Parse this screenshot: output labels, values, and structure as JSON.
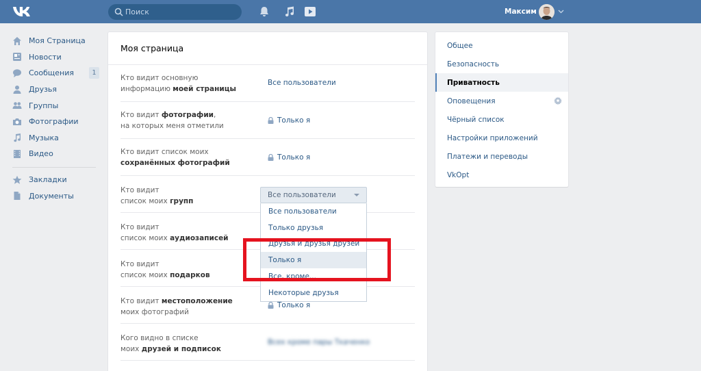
{
  "header": {
    "logo_icon": "vk-logo-icon",
    "search_placeholder": "Поиск",
    "user_name": "Максим",
    "brand_color": "#4a76a8"
  },
  "left_menu": {
    "items": [
      {
        "label": "Моя Страница",
        "icon": "home-icon"
      },
      {
        "label": "Новости",
        "icon": "news-icon"
      },
      {
        "label": "Сообщения",
        "icon": "messages-icon",
        "badge": "1"
      },
      {
        "label": "Друзья",
        "icon": "friends-icon"
      },
      {
        "label": "Группы",
        "icon": "groups-icon"
      },
      {
        "label": "Фотографии",
        "icon": "camera-icon"
      },
      {
        "label": "Музыка",
        "icon": "music-icon"
      },
      {
        "label": "Видео",
        "icon": "video-icon"
      }
    ],
    "items2": [
      {
        "label": "Закладки",
        "icon": "star-icon"
      },
      {
        "label": "Документы",
        "icon": "document-icon"
      }
    ]
  },
  "main": {
    "title": "Моя страница",
    "rows": [
      {
        "l1": "Кто видит основную",
        "l2a": "информацию ",
        "l2b": "моей страницы",
        "value": "Все пользователи"
      },
      {
        "l1a": "Кто видит ",
        "l1b": "фотографии",
        "l1c": ",",
        "l2": "на которых меня отметили",
        "value": "Только я"
      },
      {
        "l1": "Кто видит список моих",
        "l2b": "сохранённых фотографий",
        "value": "Только я"
      },
      {
        "l1": "Кто видит",
        "l2a": "список моих ",
        "l2b": "групп"
      },
      {
        "l1": "Кто видит",
        "l2a": "список моих ",
        "l2b": "аудиозаписей"
      },
      {
        "l1": "Кто видит",
        "l2a": "список моих ",
        "l2b": "подарков"
      },
      {
        "l1a": "Кто видит ",
        "l1b": "местоположение",
        "l2": "моих фотографий",
        "value": "Только я"
      },
      {
        "l1": "Кого видно в списке",
        "l2a": "моих ",
        "l2b": "друзей и подписок",
        "value": "Всех кроме пары Ткаченко"
      }
    ],
    "select": {
      "current": "Все пользователи",
      "options": [
        "Все пользователи",
        "Только друзья",
        "Друзья и друзья друзей",
        "Только я",
        "Все, кроме...",
        "Некоторые друзья"
      ],
      "highlighted_index": 3
    },
    "highlight_color": "#e5131f"
  },
  "right_menu": {
    "items": [
      {
        "label": "Общее"
      },
      {
        "label": "Безопасность"
      },
      {
        "label": "Приватность",
        "selected": true
      },
      {
        "label": "Оповещения",
        "icon": "gear-icon"
      },
      {
        "label": "Чёрный список"
      },
      {
        "label": "Настройки приложений"
      },
      {
        "label": "Платежи и переводы"
      },
      {
        "label": "VkOpt"
      }
    ]
  }
}
